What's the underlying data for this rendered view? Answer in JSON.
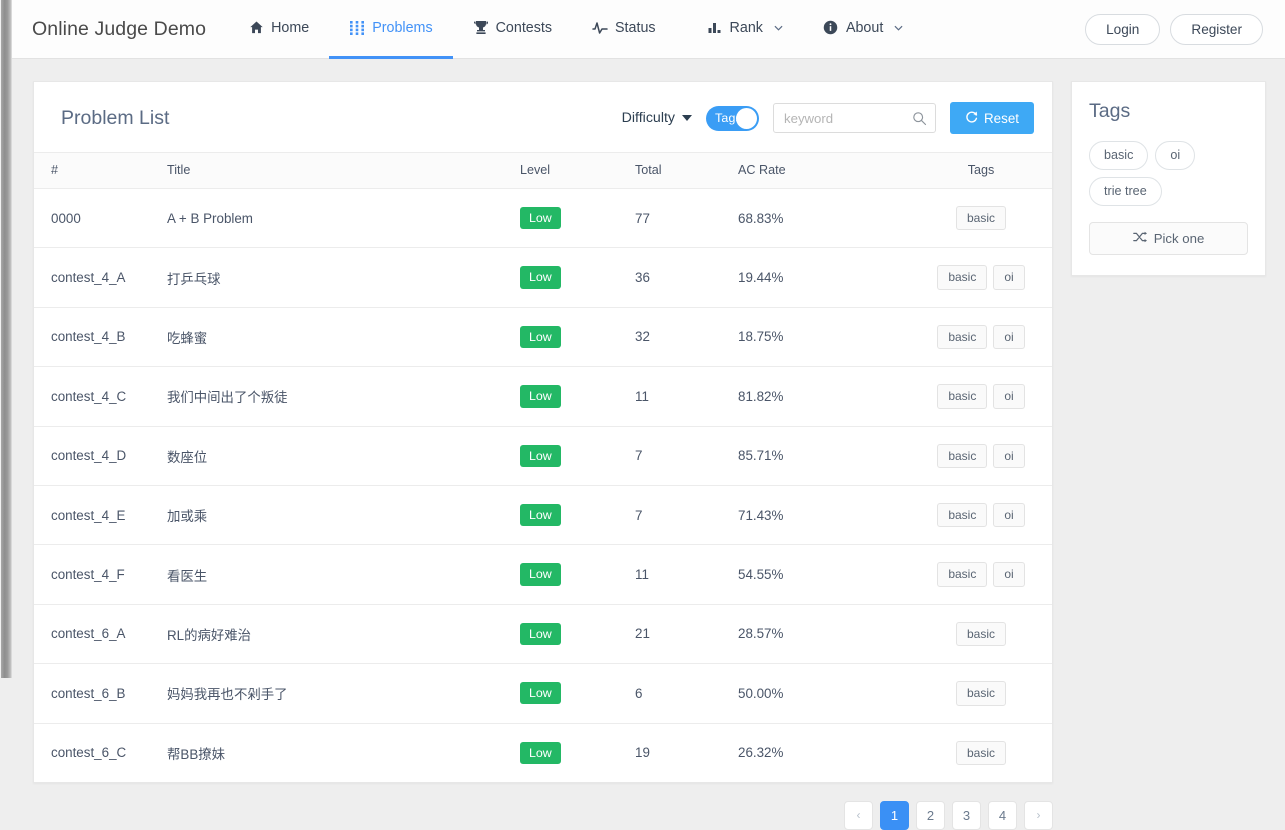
{
  "navbar": {
    "brand": "Online Judge Demo",
    "items": [
      {
        "label": "Home",
        "icon": "home-icon",
        "active": false,
        "caret": false
      },
      {
        "label": "Problems",
        "icon": "grid-icon",
        "active": true,
        "caret": false
      },
      {
        "label": "Contests",
        "icon": "trophy-icon",
        "active": false,
        "caret": false
      },
      {
        "label": "Status",
        "icon": "pulse-icon",
        "active": false,
        "caret": false
      },
      {
        "label": "Rank",
        "icon": "barchart-icon",
        "active": false,
        "caret": true
      },
      {
        "label": "About",
        "icon": "info-icon",
        "active": false,
        "caret": true
      }
    ],
    "login_label": "Login",
    "register_label": "Register"
  },
  "panel": {
    "title": "Problem List",
    "difficulty_label": "Difficulty",
    "tags_toggle_label": "Tags",
    "tags_toggle_on": true,
    "search_placeholder": "keyword",
    "search_value": "",
    "reset_label": "Reset"
  },
  "table": {
    "columns": [
      "#",
      "Title",
      "Level",
      "Total",
      "AC Rate",
      "Tags"
    ],
    "rows": [
      {
        "id": "0000",
        "title": "A + B Problem",
        "level": "Low",
        "total": "77",
        "ac_rate": "68.83%",
        "tags": [
          "basic"
        ]
      },
      {
        "id": "contest_4_A",
        "title": "打乒乓球",
        "level": "Low",
        "total": "36",
        "ac_rate": "19.44%",
        "tags": [
          "basic",
          "oi"
        ]
      },
      {
        "id": "contest_4_B",
        "title": "吃蜂蜜",
        "level": "Low",
        "total": "32",
        "ac_rate": "18.75%",
        "tags": [
          "basic",
          "oi"
        ]
      },
      {
        "id": "contest_4_C",
        "title": "我们中间出了个叛徒",
        "level": "Low",
        "total": "11",
        "ac_rate": "81.82%",
        "tags": [
          "basic",
          "oi"
        ]
      },
      {
        "id": "contest_4_D",
        "title": "数座位",
        "level": "Low",
        "total": "7",
        "ac_rate": "85.71%",
        "tags": [
          "basic",
          "oi"
        ]
      },
      {
        "id": "contest_4_E",
        "title": "加或乘",
        "level": "Low",
        "total": "7",
        "ac_rate": "71.43%",
        "tags": [
          "basic",
          "oi"
        ]
      },
      {
        "id": "contest_4_F",
        "title": "看医生",
        "level": "Low",
        "total": "11",
        "ac_rate": "54.55%",
        "tags": [
          "basic",
          "oi"
        ]
      },
      {
        "id": "contest_6_A",
        "title": "RL的病好难治",
        "level": "Low",
        "total": "21",
        "ac_rate": "28.57%",
        "tags": [
          "basic"
        ]
      },
      {
        "id": "contest_6_B",
        "title": "妈妈我再也不剁手了",
        "level": "Low",
        "total": "6",
        "ac_rate": "50.00%",
        "tags": [
          "basic"
        ]
      },
      {
        "id": "contest_6_C",
        "title": "帮BB撩妹",
        "level": "Low",
        "total": "19",
        "ac_rate": "26.32%",
        "tags": [
          "basic"
        ]
      }
    ]
  },
  "pagination": {
    "prev": "‹",
    "next": "›",
    "pages": [
      "1",
      "2",
      "3",
      "4"
    ],
    "current": "1"
  },
  "tags_panel": {
    "title": "Tags",
    "tags": [
      "basic",
      "oi",
      "trie tree"
    ],
    "pick_one_label": "Pick one"
  },
  "colors": {
    "accent_blue": "#3a90f5",
    "toggle_blue": "#3a9df5",
    "reset_blue": "#3ea9f5",
    "level_green": "#23b865",
    "text_dark": "#4a5568",
    "page_bg": "#eeeeee"
  }
}
